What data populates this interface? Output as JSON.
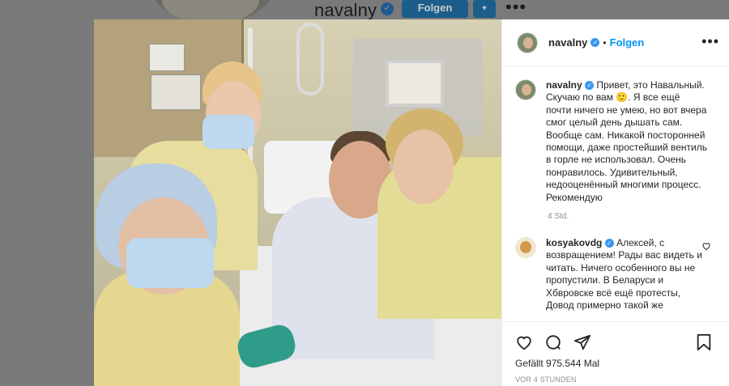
{
  "background": {
    "username": "navalny",
    "follow_label": "Folgen",
    "caret": "▾",
    "more": "•••"
  },
  "post": {
    "username": "navalny",
    "verified_icon": "verified-badge-icon",
    "dot": "•",
    "follow_label": "Folgen",
    "more": "•••",
    "caption": {
      "username": "navalny",
      "text": "Привет, это Навальный. Скучаю по вам 🙂. Я все ещё почти ничего не умею, но вот вчера смог целый день дышать сам. Вообще сам. Никакой посторонней помощи, даже простейший вентиль в горле не использовал. Очень понравилось. Удивительный, недооценённый многими процесс. Рекомендую",
      "time": "4 Std."
    },
    "comment": {
      "username": "kosyakovdg",
      "text": "Алексей, с возвращением! Рады вас видеть и читать. Ничего особенного вы не пропустили. В Беларуси и Хбвровске всё ещё протесты, Довод примерно такой же"
    },
    "likes": "Gefällt 975.544 Mal",
    "ago": "VOR 4 STUNDEN"
  },
  "colors": {
    "link_blue": "#0095f6",
    "follow_button_dim": "#1b5e8c",
    "overlay": "#7a7a7a"
  }
}
